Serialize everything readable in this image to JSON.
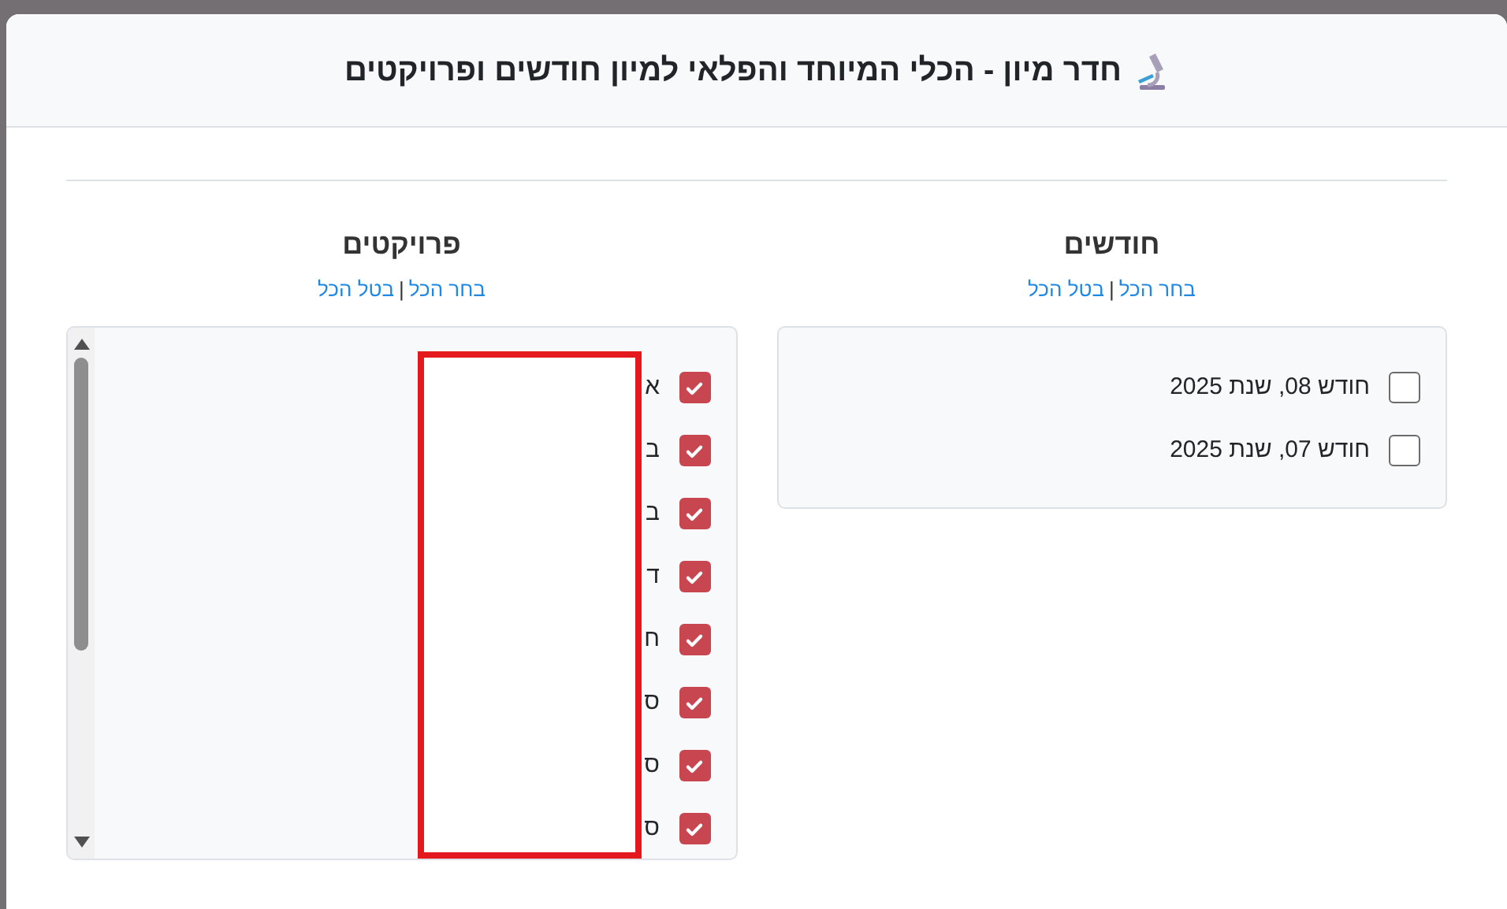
{
  "modal": {
    "title": "חדר מיון - הכלי המיוחד והפלאי למיון חודשים ופרויקטים"
  },
  "columns": [
    {
      "kind": "months",
      "heading": "חודשים",
      "select_all": "בחר הכל",
      "separator": "|",
      "clear_all": "בטל הכל",
      "items": [
        {
          "label": "חודש 08, שנת 2025",
          "checked": false
        },
        {
          "label": "חודש 07, שנת 2025",
          "checked": false
        }
      ]
    },
    {
      "kind": "projects",
      "heading": "פרויקטים",
      "select_all": "בחר הכל",
      "separator": "|",
      "clear_all": "בטל הכל",
      "redacted": true,
      "items": [
        {
          "label": "א",
          "checked": true
        },
        {
          "label": "ב",
          "checked": true
        },
        {
          "label": "ב",
          "checked": true
        },
        {
          "label": "ד",
          "checked": true
        },
        {
          "label": "ח",
          "checked": true
        },
        {
          "label": "ס",
          "checked": true
        },
        {
          "label": "ס",
          "checked": true
        },
        {
          "label": "ס",
          "checked": true
        }
      ]
    }
  ]
}
